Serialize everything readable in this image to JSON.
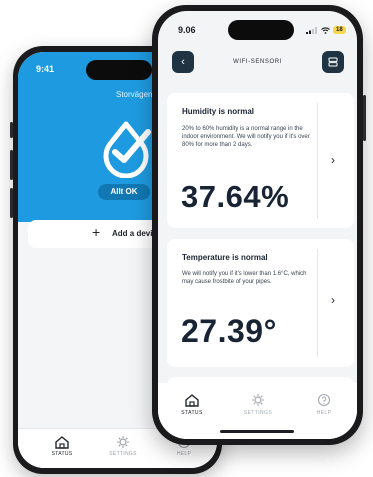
{
  "back_phone": {
    "time": "9:41",
    "location": "Storvägen 4",
    "status_badge": "Allt OK",
    "add_device_label": "Add a device",
    "tabs": [
      {
        "label": "STATUS",
        "icon": "home-icon",
        "active": true
      },
      {
        "label": "SETTINGS",
        "icon": "gear-icon",
        "active": false
      },
      {
        "label": "HELP",
        "icon": "help-icon",
        "active": false
      }
    ]
  },
  "front_phone": {
    "time": "9.06",
    "battery": "18",
    "header": {
      "title": "WIFI-SENSORI"
    },
    "cards": [
      {
        "title": "Humidity is normal",
        "description": "20% to 60% humidity is a normal range in the indoor environment. We will notify you if it's over 80% for more than 2 days.",
        "value": "37.64%"
      },
      {
        "title": "Temperature is normal",
        "description": "We will notify you if it's lower than 1.6°C, which may cause frostbite of your pipes.",
        "value": "27.39°"
      }
    ],
    "tabs": [
      {
        "label": "STATUS",
        "icon": "home-icon",
        "active": true
      },
      {
        "label": "SETTINGS",
        "icon": "gear-icon",
        "active": false
      },
      {
        "label": "HELP",
        "icon": "help-icon",
        "active": false
      }
    ]
  },
  "colors": {
    "brand_blue": "#1e9be0",
    "dark_button": "#1f3342",
    "battery_yellow": "#f7d64a"
  }
}
